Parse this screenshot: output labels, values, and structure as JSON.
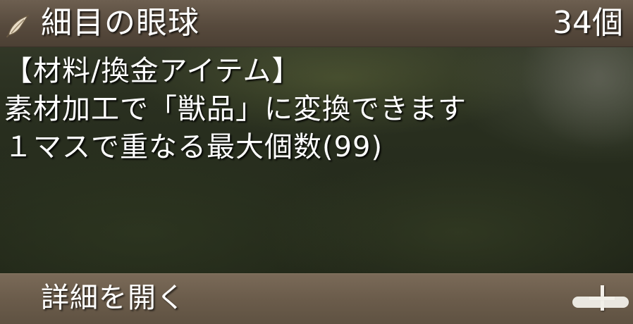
{
  "item": {
    "name": "細目の眼球",
    "count": "34個",
    "icon": "claw-material-icon"
  },
  "description": {
    "lines": [
      "【材料/換金アイテム】",
      "素材加工で「獣品」に変換できます",
      "１マスで重なる最大個数(99)"
    ]
  },
  "footer": {
    "open_details_label": "詳細を開く",
    "expand_icon": "plus-icon"
  },
  "colors": {
    "header_bg": "#574a3d",
    "footer_bg": "#6b5c4b",
    "text": "#ffffff"
  }
}
